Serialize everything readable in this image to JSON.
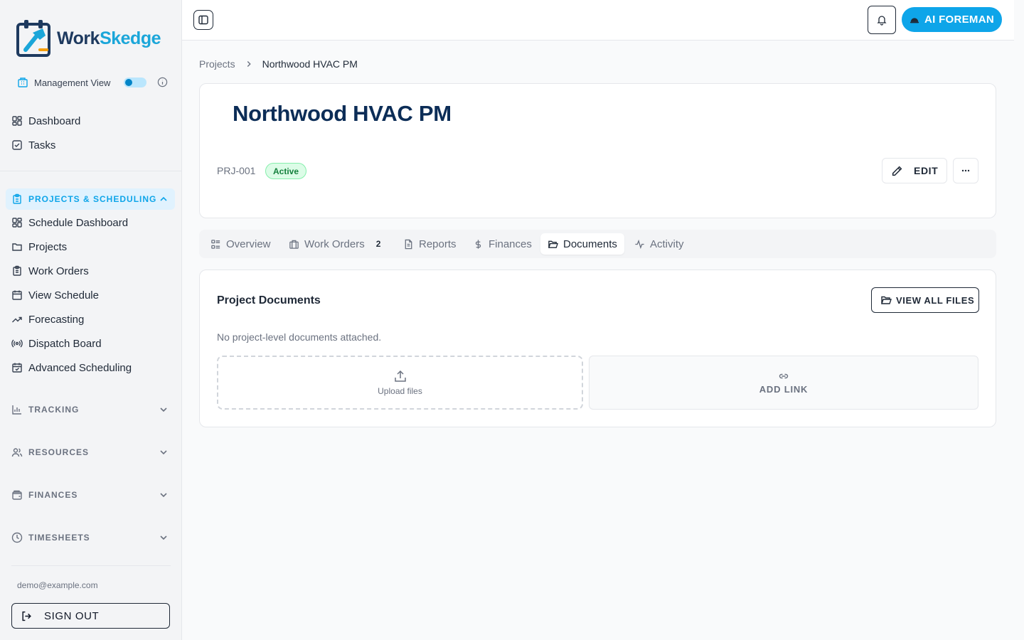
{
  "brand": {
    "name_part1": "Work",
    "name_part2": "Skedge",
    "dark_color": "#1e3a5f",
    "accent_color": "#1ba6d9"
  },
  "sidebar": {
    "management_view": {
      "label": "Management View",
      "icon": "building-icon",
      "toggle_on": true
    },
    "top_items": [
      {
        "label": "Dashboard",
        "icon": "grid-icon"
      },
      {
        "label": "Tasks",
        "icon": "check-square-icon"
      }
    ],
    "sections": [
      {
        "label": "PROJECTS & SCHEDULING",
        "icon": "clipboard-icon",
        "expanded": true,
        "items": [
          {
            "label": "Schedule Dashboard",
            "icon": "grid-icon"
          },
          {
            "label": "Projects",
            "icon": "folder-icon"
          },
          {
            "label": "Work Orders",
            "icon": "clipboard-list-icon"
          },
          {
            "label": "View Schedule",
            "icon": "calendar-icon"
          },
          {
            "label": "Forecasting",
            "icon": "trending-up-icon"
          },
          {
            "label": "Dispatch Board",
            "icon": "radio-icon"
          },
          {
            "label": "Advanced Scheduling",
            "icon": "calendar-check-icon"
          }
        ]
      },
      {
        "label": "TRACKING",
        "icon": "bar-chart-icon",
        "expanded": false
      },
      {
        "label": "RESOURCES",
        "icon": "users-icon",
        "expanded": false
      },
      {
        "label": "FINANCES",
        "icon": "wallet-icon",
        "expanded": false
      },
      {
        "label": "TIMESHEETS",
        "icon": "clock-icon",
        "expanded": false
      }
    ],
    "user_email": "demo@example.com",
    "sign_out_label": "SIGN OUT"
  },
  "topbar": {
    "ai_button_label": "AI FOREMAN",
    "ai_button_color": "#0ea5e9"
  },
  "breadcrumb": {
    "root": "Projects",
    "current": "Northwood HVAC PM"
  },
  "project": {
    "title": "Northwood HVAC PM",
    "id": "PRJ-001",
    "status": "Active",
    "status_color": "#15803d",
    "edit_label": "EDIT"
  },
  "tabs": [
    {
      "label": "Overview",
      "icon": "list-icon"
    },
    {
      "label": "Work Orders",
      "icon": "briefcase-icon",
      "count": "2"
    },
    {
      "label": "Reports",
      "icon": "file-text-icon"
    },
    {
      "label": "Finances",
      "icon": "dollar-icon"
    },
    {
      "label": "Documents",
      "icon": "folder-open-icon",
      "active": true
    },
    {
      "label": "Activity",
      "icon": "activity-icon"
    }
  ],
  "documents": {
    "title": "Project Documents",
    "view_all_label": "VIEW ALL FILES",
    "empty_text": "No project-level documents attached.",
    "upload_label": "Upload files",
    "add_link_label": "ADD LINK"
  }
}
